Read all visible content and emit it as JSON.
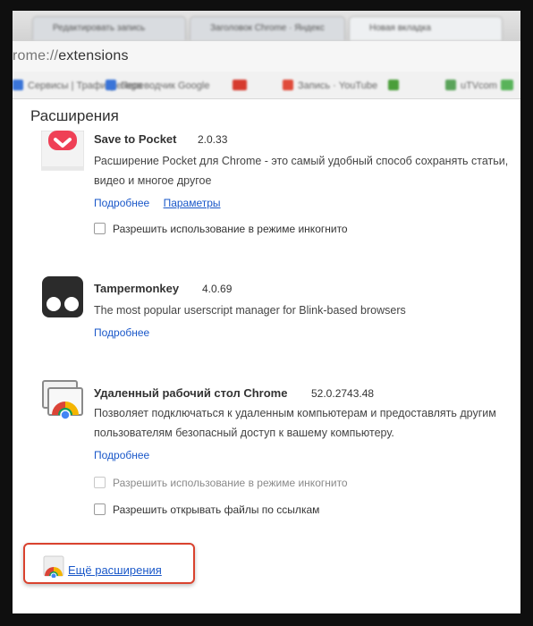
{
  "browser": {
    "tabs": [
      {
        "label": "Редактировать запись"
      },
      {
        "label": "Заголовок Chrome · Яндекс"
      },
      {
        "label": "Новая вкладка"
      }
    ],
    "url": {
      "scheme": "rome://",
      "path": "extensions"
    },
    "bookmarks": [
      {
        "label": "Сервисы | Трафикрезерв",
        "color": "#3a74d8"
      },
      {
        "label": "Переводчик Google",
        "color": "#3a74d8"
      },
      {
        "label": "",
        "color": "#d63b2f"
      },
      {
        "label": "Запись · YouTube",
        "color": "#e04b3a"
      },
      {
        "label": "",
        "color": "#4a9e3a"
      },
      {
        "label": "uTVcom",
        "color": "#5aa35a"
      },
      {
        "label": "",
        "color": "#58b35a"
      }
    ]
  },
  "page": {
    "title": "Расширения",
    "extensions": [
      {
        "name": "Save to Pocket",
        "version": "2.0.33",
        "description_lines": [
          "Расширение Pocket для Chrome - это самый удобный способ сохранять статьи,",
          "видео и многое другое"
        ],
        "details_link": "Подробнее",
        "options_link": "Параметры",
        "checkboxes": [
          {
            "label": "Разрешить использование в режиме инкогнито",
            "checked": false,
            "disabled": false
          }
        ]
      },
      {
        "name": "Tampermonkey",
        "version": "4.0.69",
        "description_lines": [
          "The most popular userscript manager for Blink-based browsers"
        ],
        "details_link": "Подробнее",
        "checkboxes": []
      },
      {
        "name": "Удаленный рабочий стол Chrome",
        "version": "52.0.2743.48",
        "description_lines": [
          "Позволяет подключаться к удаленным компьютерам и предоставлять другим",
          "пользователям безопасный доступ к вашему компьютеру."
        ],
        "details_link": "Подробнее",
        "checkboxes": [
          {
            "label": "Разрешить использование в режиме инкогнито",
            "checked": false,
            "disabled": true
          },
          {
            "label": "Разрешить открывать файлы по ссылкам",
            "checked": false,
            "disabled": false
          }
        ]
      }
    ],
    "more_extensions_link": "Ещё расширения",
    "highlight_color": "#d9422e"
  }
}
